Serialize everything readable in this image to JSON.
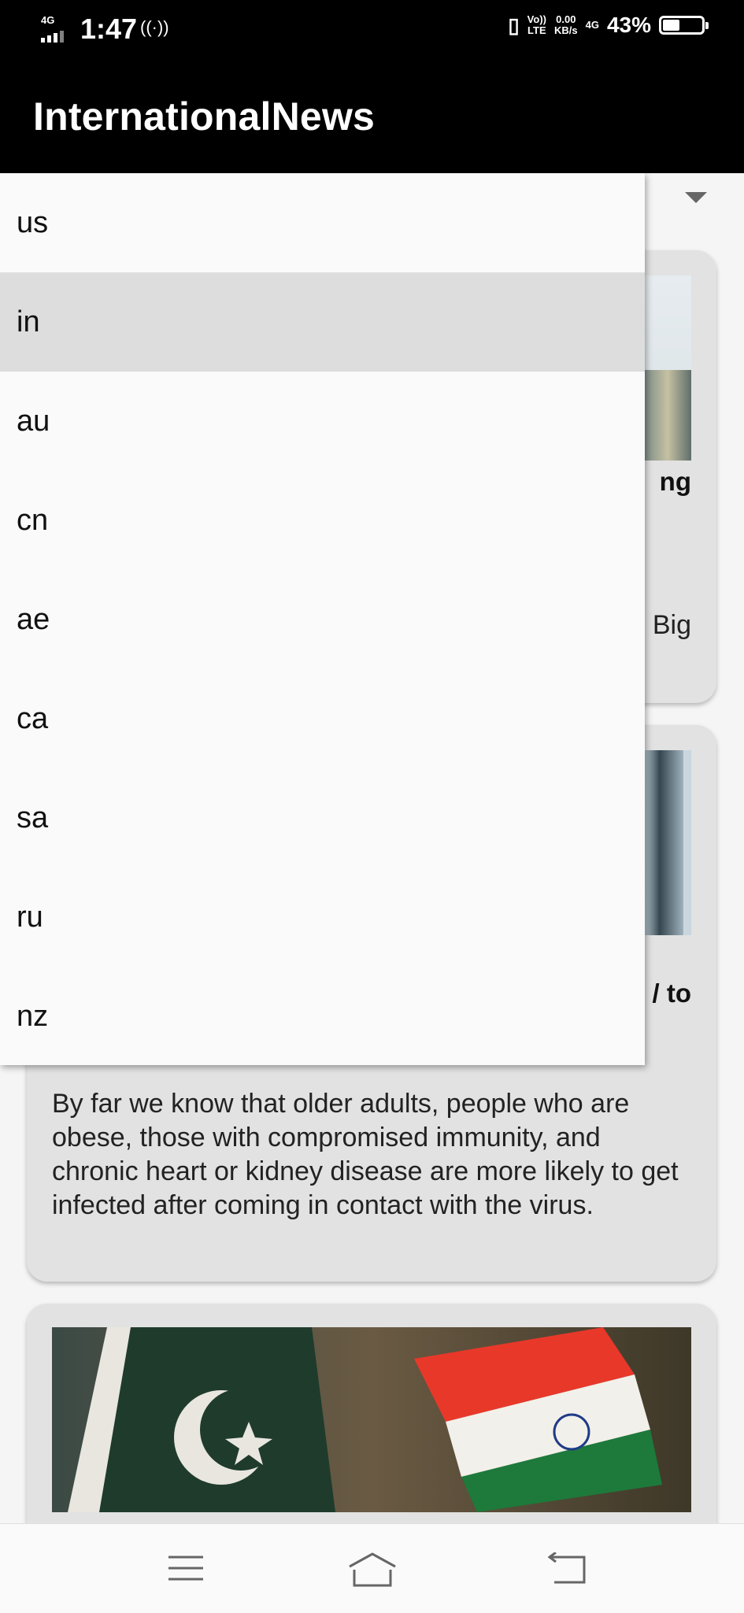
{
  "status_bar": {
    "network": "4G",
    "time": "1:47",
    "hotspot_icon": "hotspot-icon",
    "volte": "Vo))\nLTE",
    "speed": "0.00\nKB/s",
    "data_type": "4G",
    "battery": "43%",
    "battery_level": 0.43
  },
  "app": {
    "title": "InternationalNews"
  },
  "dropdown": {
    "selected": "in",
    "options": [
      "us",
      "in",
      "au",
      "cn",
      "ae",
      "ca",
      "sa",
      "ru",
      "nz"
    ]
  },
  "articles": [
    {
      "headline_fragment": "ng",
      "desc_fragment": "Big"
    },
    {
      "headline_fragment": "/ to",
      "description": "By far we know that older adults, people who are obese, those with compromised immunity, and chronic heart or kidney disease are more likely to get infected after coming in contact with the virus."
    },
    {
      "image": "pakistan-india-flags-image"
    }
  ],
  "nav": {
    "icons": [
      "menu-icon",
      "home-icon",
      "back-icon"
    ]
  }
}
